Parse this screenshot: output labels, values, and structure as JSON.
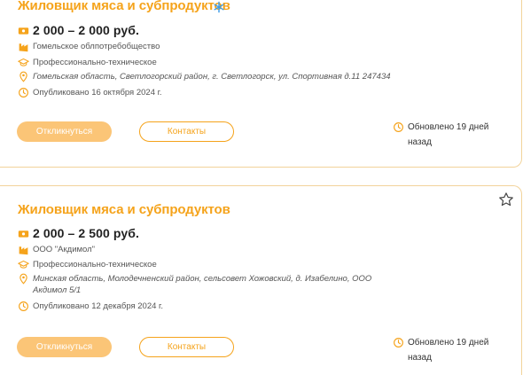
{
  "vacancies": [
    {
      "title": "Жиловщик мяса и субпродуктов",
      "salary": "2 000 – 2 000 руб.",
      "company": "Гомельское облпотребобщество",
      "education": "Профессионально-техническое",
      "address": "Гомельская область, Светлогорский район, г. Светлогорск, ул. Спортивная д.11 247434",
      "published": "Опубликовано 16 октября 2024 г.",
      "apply_label": "Откликнуться",
      "contacts_label": "Контакты",
      "updated": "Обновлено 19 дней назад"
    },
    {
      "title": "Жиловщик мяса и субпродуктов",
      "salary": "2 000 – 2 500 руб.",
      "company": "ООО \"Акдимол\"",
      "education": "Профессионально-техническое",
      "address": "Минская область, Молодечненский район, сельсовет Хожовский, д. Изабелино, ООО Акдимол 5/1",
      "published": "Опубликовано 12 декабря 2024 г.",
      "apply_label": "Откликнуться",
      "contacts_label": "Контакты",
      "updated": "Обновлено 19 дней назад"
    }
  ],
  "icons": {
    "salary": "money-icon",
    "company": "building-icon",
    "education": "graduation-cap-icon",
    "address": "location-pin-icon",
    "published": "clock-icon",
    "updated": "clock-icon",
    "favorite": "star-icon",
    "featured": "sparkle-icon"
  },
  "colors": {
    "accent": "#f5a31b",
    "button_fill": "#fbc577",
    "card_border": "#f2d39a",
    "featured_sparkle": "#3b9be8"
  }
}
